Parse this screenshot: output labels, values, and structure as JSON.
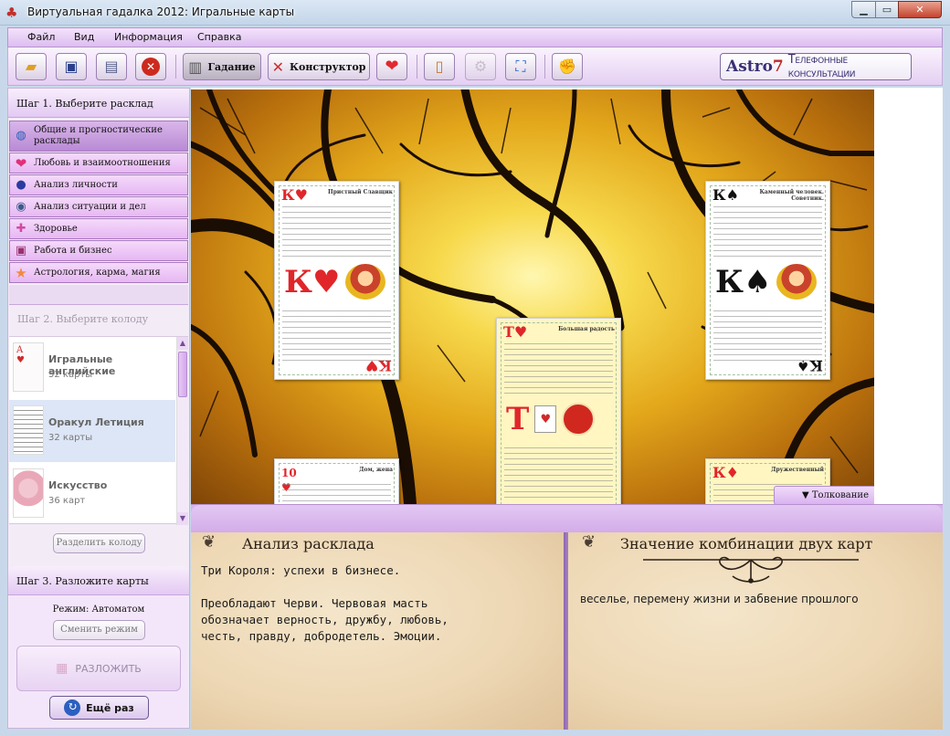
{
  "window": {
    "title": "Виртуальная гадалка 2012: Игральные карты",
    "minimize": "▁",
    "maximize": "▭",
    "close": "✕"
  },
  "menu": [
    "Файл",
    "Вид",
    "Информация",
    "Справка"
  ],
  "toolbar": {
    "gadanie_label": "Гадание",
    "constructor_label": "Конструктор",
    "banner_brand": "Astro",
    "banner_brand_num": "7",
    "banner_tagline": "Телефонные консультации"
  },
  "step1": {
    "title": "Шаг 1. Выберите расклад",
    "items": [
      {
        "label": "Общие и прогностические расклады",
        "icon": "globe-icon",
        "color": "#3d6fc2",
        "glyph": "◍"
      },
      {
        "label": "Любовь и взаимоотношения",
        "icon": "heart-icon",
        "color": "#e0307a",
        "glyph": "❤"
      },
      {
        "label": "Анализ личности",
        "icon": "person-icon",
        "color": "#2b3aa0",
        "glyph": "●"
      },
      {
        "label": "Анализ ситуации и дел",
        "icon": "planet-icon",
        "color": "#3b5a8a",
        "glyph": "◉"
      },
      {
        "label": "Здоровье",
        "icon": "health-icon",
        "color": "#d04aa0",
        "glyph": "✚"
      },
      {
        "label": "Работа и бизнес",
        "icon": "briefcase-icon",
        "color": "#9a3070",
        "glyph": "▣"
      },
      {
        "label": "Астрология, карма, магия",
        "icon": "star-icon",
        "color": "#f08a40",
        "glyph": "★"
      }
    ]
  },
  "step2": {
    "title": "Шаг 2. Выберите колоду",
    "decks": [
      {
        "name": "Игральные английские",
        "count": "52 карты"
      },
      {
        "name": "Оракул Летиция",
        "count": "32 карты"
      },
      {
        "name": "Искусство",
        "count": "36 карт"
      }
    ],
    "split_label": "Разделить колоду"
  },
  "step3": {
    "title": "Шаг 3. Разложите карты",
    "mode": "Режим: Автоматом",
    "change_mode": "Сменить режим",
    "deal": "РАЗЛОЖИТЬ",
    "again": "Ещё раз"
  },
  "board": {
    "interp_tab": "▼ Толкование",
    "cards": [
      {
        "rank": "К",
        "suit": "♥",
        "color": "red",
        "title": "Пристный Славщик",
        "theme": "white"
      },
      {
        "rank": "К",
        "suit": "♠",
        "color": "black",
        "title": "Каменный человек. Советник.",
        "theme": "white"
      },
      {
        "rank": "Т",
        "suit": "♥",
        "color": "red",
        "title": "Большая радость",
        "theme": "yellow"
      },
      {
        "rank": "10",
        "suit": "♥",
        "color": "red",
        "title": "Дом, жена",
        "theme": "white"
      },
      {
        "rank": "К",
        "suit": "♦",
        "color": "red",
        "title": "Дружественный",
        "theme": "yellow"
      }
    ]
  },
  "analysis": {
    "title": "Анализ расклада",
    "text": "Три Короля: успехи в бизнесе.\n\nПреобладают Черви. Червовая масть обозначает верность, дружбу, любовь, честь, правду, добродетель. Эмоции."
  },
  "combo": {
    "title": "Значение комбинации двух карт",
    "text": "веселье, перемену жизни и забвение прошлого"
  }
}
